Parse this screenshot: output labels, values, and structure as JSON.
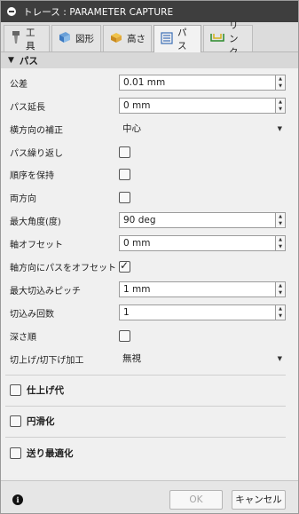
{
  "title": "トレース : PARAMETER CAPTURE",
  "tabs": [
    {
      "label": "工具",
      "icon": "tool-icon"
    },
    {
      "label": "図形",
      "icon": "shape-icon"
    },
    {
      "label": "高さ",
      "icon": "height-icon"
    },
    {
      "label": "パス",
      "icon": "passes-icon",
      "active": true
    },
    {
      "label": "リンク",
      "icon": "link-icon"
    }
  ],
  "section": {
    "title": "パス",
    "expanded": true
  },
  "fields": {
    "tolerance": {
      "label": "公差",
      "value": "0.01 mm"
    },
    "pass_extension": {
      "label": "パス延長",
      "value": "0 mm"
    },
    "sideways_compensation": {
      "label": "横方向の補正",
      "value": "中心"
    },
    "repeat_passes": {
      "label": "パス繰り返し",
      "checked": false
    },
    "preserve_order": {
      "label": "順序を保持",
      "checked": false
    },
    "both_ways": {
      "label": "両方向",
      "checked": false
    },
    "max_angle": {
      "label": "最大角度(度)",
      "value": "90 deg"
    },
    "axial_offset": {
      "label": "軸オフセット",
      "value": "0 mm"
    },
    "axial_offset_passes": {
      "label": "軸方向にパスをオフセット",
      "checked": true
    },
    "max_stepdown": {
      "label": "最大切込みピッチ",
      "value": "1 mm"
    },
    "num_stepdowns": {
      "label": "切込み回数",
      "value": "1"
    },
    "order_by_depth": {
      "label": "深さ順",
      "checked": false
    },
    "ramp_type": {
      "label": "切上げ/切下げ加工",
      "value": "無視"
    }
  },
  "groups": [
    {
      "label": "仕上げ代",
      "checked": false
    },
    {
      "label": "円滑化",
      "checked": false
    },
    {
      "label": "送り最適化",
      "checked": false
    }
  ],
  "footer": {
    "ok_label": "OK",
    "cancel_label": "キャンセル"
  }
}
